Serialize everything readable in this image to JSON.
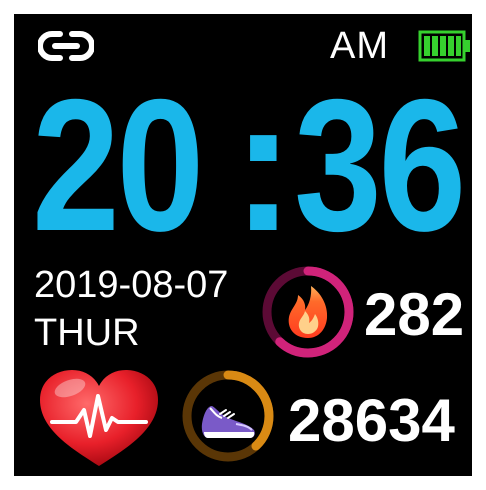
{
  "status_bar": {
    "connection_icon": "link-icon",
    "ampm": "AM",
    "battery_icon": "battery-full-icon",
    "battery_color": "#36d12e"
  },
  "clock": {
    "hours": "20",
    "separator": ":",
    "minutes": "36",
    "color": "#1ab7ea"
  },
  "date": {
    "date": "2019-08-07",
    "weekday": "THUR"
  },
  "calories": {
    "icon": "flame-icon",
    "value": "282",
    "ring_color": "#d0237a",
    "ring_progress": 0.62
  },
  "heart_rate": {
    "icon": "heart-pulse-icon"
  },
  "steps": {
    "icon": "sneaker-icon",
    "value": "28634",
    "ring_color": "#d98a14",
    "ring_progress": 0.38
  }
}
